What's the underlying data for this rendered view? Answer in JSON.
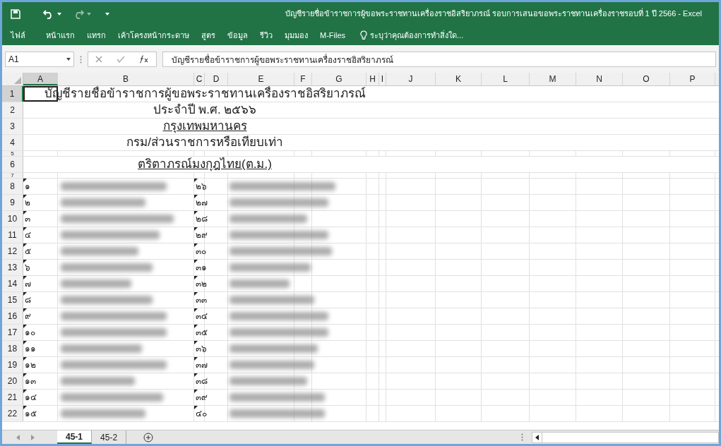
{
  "title_bar": {
    "title": "บัญชีรายชื่อข้าราชการผู้ขอพระราชทานเครื่องราชอิสริยาภรณ์ รอบการเสนอขอพระราชทานเครื่องราชรอบที่ 1  ปี 2566  - Excel"
  },
  "ribbon_tabs": [
    {
      "label": "ไฟล์"
    },
    {
      "label": "หน้าแรก"
    },
    {
      "label": "แทรก"
    },
    {
      "label": "เค้าโครงหน้ากระดาษ"
    },
    {
      "label": "สูตร"
    },
    {
      "label": "ข้อมูล"
    },
    {
      "label": "รีวิว"
    },
    {
      "label": "มุมมอง"
    },
    {
      "label": "M-Files"
    }
  ],
  "tell_me": {
    "placeholder": "ระบุว่าคุณต้องการทำสิ่งใด..."
  },
  "name_box": {
    "value": "A1"
  },
  "formula_bar": {
    "value": "บัญชีรายชื่อข้าราชการผู้ขอพระราชทานเครื่องราชอิสริยาภรณ์"
  },
  "columns": [
    {
      "label": "A",
      "selected": true
    },
    {
      "label": "B",
      "selected": false
    },
    {
      "label": "C",
      "selected": false
    },
    {
      "label": "D",
      "selected": false
    },
    {
      "label": "E",
      "selected": false
    },
    {
      "label": "F",
      "selected": false
    },
    {
      "label": "G",
      "selected": false
    },
    {
      "label": "H",
      "selected": false
    },
    {
      "label": "I",
      "selected": false
    },
    {
      "label": "J",
      "selected": false
    },
    {
      "label": "K",
      "selected": false
    },
    {
      "label": "L",
      "selected": false
    },
    {
      "label": "M",
      "selected": false
    },
    {
      "label": "N",
      "selected": false
    },
    {
      "label": "O",
      "selected": false
    },
    {
      "label": "P",
      "selected": false
    }
  ],
  "rows": [
    {
      "number": "1",
      "kind": "title",
      "selected": true,
      "text": "บัญชีรายชื่อข้าราชการผู้ขอพระราชทานเครื่องราชอิสริยาภรณ์",
      "underlined": false
    },
    {
      "number": "2",
      "kind": "title",
      "selected": false,
      "text": "ประจำปี พ.ศ. ๒๕๖๖",
      "underlined": false
    },
    {
      "number": "3",
      "kind": "title",
      "selected": false,
      "text": "กรุงเทพมหานคร",
      "underlined": true
    },
    {
      "number": "4",
      "kind": "title",
      "selected": false,
      "text": "กรม/ส่วนราชการหรือเทียบเท่า",
      "underlined": false
    },
    {
      "number": "5",
      "kind": "spacer",
      "selected": false
    },
    {
      "number": "6",
      "kind": "title",
      "selected": false,
      "text": "ตริตาภรณ์มงกุฎไทย(ต.ม.)",
      "underlined": true
    },
    {
      "number": "7",
      "kind": "spacer",
      "selected": false
    },
    {
      "number": "8",
      "kind": "entry",
      "selected": false,
      "left_no": "๑",
      "right_no": "๒๖"
    },
    {
      "number": "9",
      "kind": "entry",
      "selected": false,
      "left_no": "๒",
      "right_no": "๒๗"
    },
    {
      "number": "10",
      "kind": "entry",
      "selected": false,
      "left_no": "๓",
      "right_no": "๒๘"
    },
    {
      "number": "11",
      "kind": "entry",
      "selected": false,
      "left_no": "๔",
      "right_no": "๒๙"
    },
    {
      "number": "12",
      "kind": "entry",
      "selected": false,
      "left_no": "๕",
      "right_no": "๓๐"
    },
    {
      "number": "13",
      "kind": "entry",
      "selected": false,
      "left_no": "๖",
      "right_no": "๓๑"
    },
    {
      "number": "14",
      "kind": "entry",
      "selected": false,
      "left_no": "๗",
      "right_no": "๓๒"
    },
    {
      "number": "15",
      "kind": "entry",
      "selected": false,
      "left_no": "๘",
      "right_no": "๓๓"
    },
    {
      "number": "16",
      "kind": "entry",
      "selected": false,
      "left_no": "๙",
      "right_no": "๓๔"
    },
    {
      "number": "17",
      "kind": "entry",
      "selected": false,
      "left_no": "๑๐",
      "right_no": "๓๕"
    },
    {
      "number": "18",
      "kind": "entry",
      "selected": false,
      "left_no": "๑๑",
      "right_no": "๓๖"
    },
    {
      "number": "19",
      "kind": "entry",
      "selected": false,
      "left_no": "๑๒",
      "right_no": "๓๗"
    },
    {
      "number": "20",
      "kind": "entry",
      "selected": false,
      "left_no": "๑๓",
      "right_no": "๓๘"
    },
    {
      "number": "21",
      "kind": "entry",
      "selected": false,
      "left_no": "๑๔",
      "right_no": "๓๙"
    },
    {
      "number": "22",
      "kind": "entry",
      "selected": false,
      "left_no": "๑๕",
      "right_no": "๔๐"
    }
  ],
  "sheet_tabs": [
    {
      "label": "45-1",
      "selected": true
    },
    {
      "label": "45-2",
      "selected": false
    }
  ]
}
